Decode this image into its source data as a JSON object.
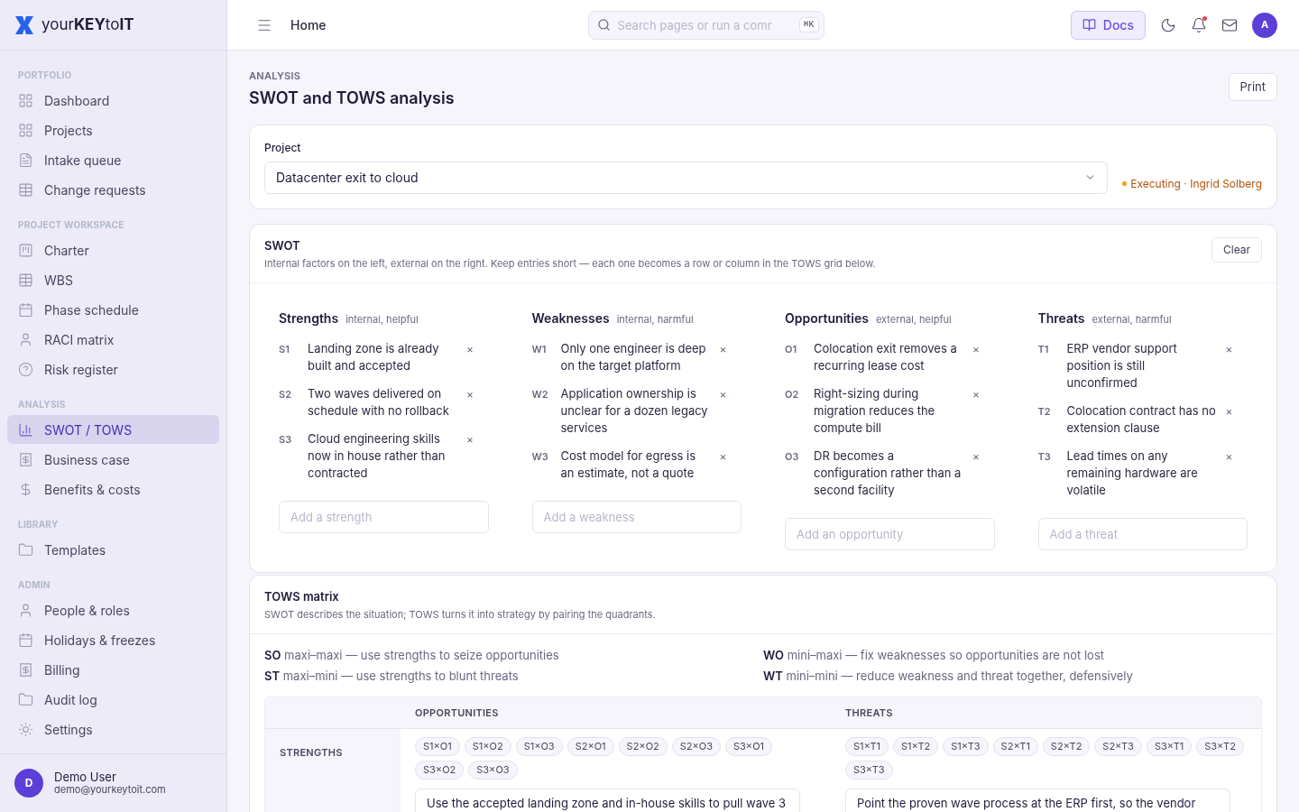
{
  "brand": "your**KEY**to**IT**",
  "sidebar": {
    "sections": [
      {
        "title": "PORTFOLIO",
        "items": [
          {
            "label": "Dashboard",
            "selected": false
          },
          {
            "label": "Projects",
            "selected": false
          },
          {
            "label": "Intake queue",
            "selected": false
          },
          {
            "label": "Change requests",
            "selected": false
          }
        ]
      },
      {
        "title": "PROJECT WORKSPACE",
        "items": [
          {
            "label": "Charter",
            "selected": false
          },
          {
            "label": "WBS",
            "selected": false
          },
          {
            "label": "Phase schedule",
            "selected": false
          },
          {
            "label": "RACI matrix",
            "selected": false
          },
          {
            "label": "Risk register",
            "selected": false
          }
        ]
      },
      {
        "title": "ANALYSIS",
        "items": [
          {
            "label": "SWOT / TOWS",
            "selected": true
          },
          {
            "label": "Business case",
            "selected": false
          },
          {
            "label": "Benefits & costs",
            "selected": false
          }
        ]
      },
      {
        "title": "LIBRARY",
        "items": [
          {
            "label": "Templates",
            "selected": false
          }
        ]
      },
      {
        "title": "ADMIN",
        "items": [
          {
            "label": "People & roles",
            "selected": false
          },
          {
            "label": "Holidays & freezes",
            "selected": false
          },
          {
            "label": "Billing",
            "selected": false
          },
          {
            "label": "Audit log",
            "selected": false
          },
          {
            "label": "Settings",
            "selected": false
          }
        ]
      }
    ],
    "user": {
      "initial": "D",
      "name": "Demo User",
      "email": "demo@yourkeytoit.com"
    }
  },
  "topbar": {
    "breadcrumb": "Home",
    "search_placeholder": "Search pages or run a comr",
    "shortcut": "⌘K",
    "docs": "Docs",
    "notification_dot": true,
    "avatar": "A"
  },
  "page": {
    "eyebrow": "ANALYSIS",
    "title": "SWOT and TOWS analysis",
    "print": "Print"
  },
  "project": {
    "label": "Project",
    "value": "Datacenter exit to cloud",
    "status": "Executing · Ingrid Solberg"
  },
  "swot": {
    "title": "SWOT",
    "description": "Internal factors on the left, external on the right. Keep entries short — each one becomes a row or column in the TOWS grid below.",
    "clear": "Clear",
    "quadrants": [
      {
        "title": "Strengths",
        "hint": "internal, helpful",
        "placeholder": "Add a strength",
        "entries": [
          {
            "code": "S1",
            "text": "Landing zone is already built and accepted"
          },
          {
            "code": "S2",
            "text": "Two waves delivered on schedule with no rollback"
          },
          {
            "code": "S3",
            "text": "Cloud engineering skills now in house rather than contracted"
          }
        ]
      },
      {
        "title": "Weaknesses",
        "hint": "internal, harmful",
        "placeholder": "Add a weakness",
        "entries": [
          {
            "code": "W1",
            "text": "Only one engineer is deep on the target platform"
          },
          {
            "code": "W2",
            "text": "Application ownership is unclear for a dozen legacy services"
          },
          {
            "code": "W3",
            "text": "Cost model for egress is an estimate, not a quote"
          }
        ]
      },
      {
        "title": "Opportunities",
        "hint": "external, helpful",
        "placeholder": "Add an opportunity",
        "entries": [
          {
            "code": "O1",
            "text": "Colocation exit removes a recurring lease cost"
          },
          {
            "code": "O2",
            "text": "Right-sizing during migration reduces the compute bill"
          },
          {
            "code": "O3",
            "text": "DR becomes a configuration rather than a second facility"
          }
        ]
      },
      {
        "title": "Threats",
        "hint": "external, harmful",
        "placeholder": "Add a threat",
        "entries": [
          {
            "code": "T1",
            "text": "ERP vendor support position is still unconfirmed"
          },
          {
            "code": "T2",
            "text": "Colocation contract has no extension clause"
          },
          {
            "code": "T3",
            "text": "Lead times on any remaining hardware are volatile"
          }
        ]
      }
    ],
    "remove_glyph": "×"
  },
  "tows": {
    "title": "TOWS matrix",
    "description": "SWOT describes the situation; TOWS turns it into strategy by pairing the quadrants.",
    "legend": [
      {
        "code": "SO",
        "text": "maxi–maxi — use strengths to seize opportunities"
      },
      {
        "code": "WO",
        "text": "mini–maxi — fix weaknesses so opportunities are not lost"
      },
      {
        "code": "ST",
        "text": "maxi–mini — use strengths to blunt threats"
      },
      {
        "code": "WT",
        "text": "mini–mini — reduce weakness and threat together, defensively"
      }
    ],
    "columns": [
      "OPPORTUNITIES",
      "THREATS"
    ],
    "rows": [
      {
        "label": "STRENGTHS",
        "cells": [
          {
            "pairs": [
              "S1×O1",
              "S1×O2",
              "S1×O3",
              "S2×O1",
              "S2×O2",
              "S2×O3",
              "S3×O1",
              "S3×O2",
              "S3×O3"
            ],
            "strategy": "Use the accepted landing zone and in-house skills to pull wave 3"
          },
          {
            "pairs": [
              "S1×T1",
              "S1×T2",
              "S1×T3",
              "S2×T1",
              "S2×T2",
              "S2×T3",
              "S3×T1",
              "S3×T2",
              "S3×T3"
            ],
            "strategy": "Point the proven wave process at the ERP first, so the vendor"
          }
        ]
      }
    ]
  }
}
